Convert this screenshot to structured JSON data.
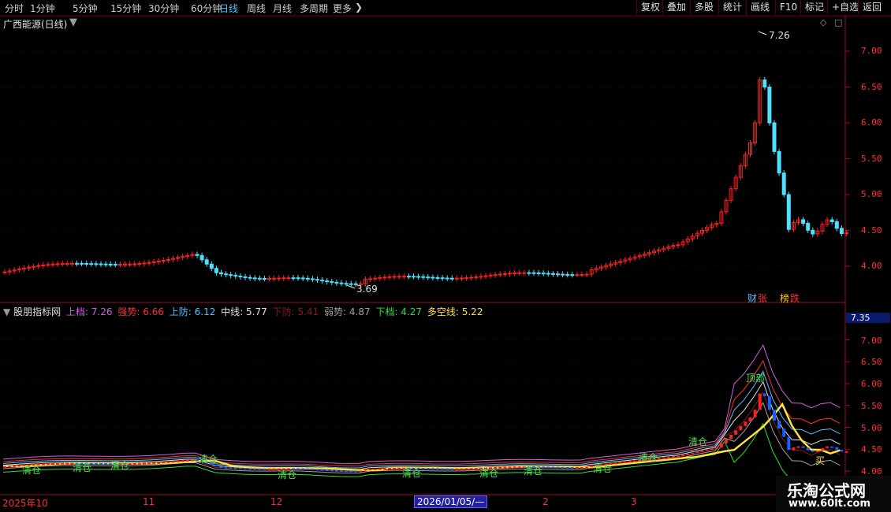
{
  "toolbar": {
    "periods": [
      "分时",
      "1分钟",
      "5分钟",
      "15分钟",
      "30分钟",
      "60分钟",
      "日线",
      "周线",
      "月线",
      "多周期",
      "更多"
    ],
    "active_period": "日线",
    "right_buttons": [
      "复权",
      "叠加",
      "多股",
      "统计",
      "画线",
      "F10",
      "标记",
      "+自选",
      "返回"
    ]
  },
  "main_chart": {
    "title": "广西能源(日线)",
    "high_label": "7.26",
    "low_label": "3.69",
    "y_ticks": [
      "7.00",
      "6.50",
      "6.00",
      "5.50",
      "5.00",
      "4.50",
      "4.00"
    ],
    "badges": [
      {
        "text": "财",
        "color": "#4fc3ff"
      },
      {
        "text": "张",
        "color": "#ff3030"
      },
      {
        "text": "榜",
        "color": "#ffcc00"
      },
      {
        "text": "跌",
        "color": "#ff3030"
      }
    ]
  },
  "indicator": {
    "name": "股朋指标网",
    "lines": [
      {
        "label": "上档",
        "value": "7.26",
        "color": "#d060e0"
      },
      {
        "label": "强势",
        "value": "6.66",
        "color": "#ff3030"
      },
      {
        "label": "上防",
        "value": "6.12",
        "color": "#4fc3ff"
      },
      {
        "label": "中线",
        "value": "5.77",
        "color": "#e0e0e0"
      },
      {
        "label": "下防",
        "value": "5.41",
        "color": "#8a1a1a"
      },
      {
        "label": "弱势",
        "value": "4.87",
        "color": "#a0a0a0"
      },
      {
        "label": "下档",
        "value": "4.27",
        "color": "#30e030"
      },
      {
        "label": "多空线",
        "value": "5.22",
        "color": "#ffe040"
      }
    ],
    "current_price_tag": "7.35",
    "y_ticks": [
      "7.00",
      "6.50",
      "6.00",
      "5.50",
      "5.00",
      "4.50",
      "4.00"
    ],
    "signal_labels": [
      "清仓",
      "清仓",
      "清仓",
      "清仓",
      "清仓",
      "清仓",
      "清仓",
      "清仓",
      "清仓",
      "清仓",
      "清仓",
      "顶部",
      "买"
    ]
  },
  "date_axis": {
    "labels": [
      "2025年10",
      "11",
      "12",
      "2",
      "3"
    ],
    "cursor_date": "2026/01/05/—"
  },
  "watermark": {
    "title": "乐淘公式网",
    "url": "www.60lt.com"
  },
  "colors": {
    "up": "#ff2020",
    "down": "#4fe0ff",
    "frame": "#5a0000"
  }
}
